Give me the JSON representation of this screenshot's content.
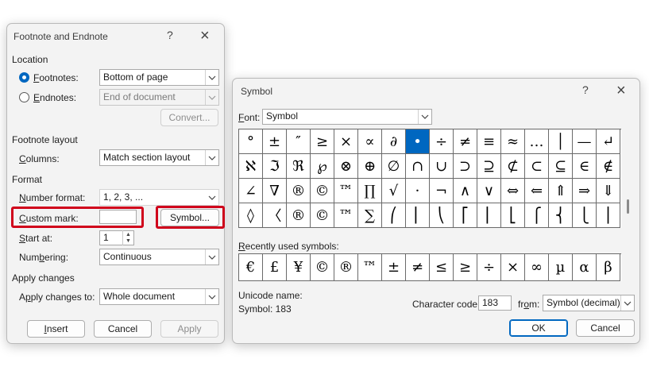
{
  "footnote_dialog": {
    "title": "Footnote and Endnote",
    "help": "?",
    "close": "×",
    "location": {
      "heading": "Location",
      "footnotes": {
        "label_key": "F",
        "label_rest": "ootnotes:",
        "value": "Bottom of page",
        "selected": true
      },
      "endnotes": {
        "label_key": "E",
        "label_rest": "ndnotes:",
        "value": "End of document",
        "selected": false
      },
      "convert": "Convert..."
    },
    "layout": {
      "heading": "Footnote layout",
      "columns_key": "C",
      "columns_rest": "olumns:",
      "columns_value": "Match section layout"
    },
    "format": {
      "heading": "Format",
      "number_format_key": "N",
      "number_format_rest": "umber format:",
      "number_format_value": "1, 2, 3, ...",
      "custom_mark_key": "C",
      "custom_mark_rest": "ustom mark:",
      "custom_mark_value": "",
      "symbol_button": "Symbol...",
      "start_at_key": "S",
      "start_at_rest": "tart at:",
      "start_at_value": "1",
      "numbering_pre": "Num",
      "numbering_key": "b",
      "numbering_rest": "ering:",
      "numbering_value": "Continuous"
    },
    "apply": {
      "heading": "Apply changes",
      "label_pre": "A",
      "label_key": "p",
      "label_rest": "ply changes to:",
      "value": "Whole document"
    },
    "buttons": {
      "insert_key": "I",
      "insert_rest": "nsert",
      "cancel": "Cancel",
      "apply": "Apply"
    }
  },
  "symbol_dialog": {
    "title": "Symbol",
    "help": "?",
    "close": "×",
    "font_key": "F",
    "font_rest": "ont:",
    "font_value": "Symbol",
    "symbols": [
      "°",
      "±",
      "″",
      "≥",
      "×",
      "∝",
      "∂",
      "•",
      "÷",
      "≠",
      "≡",
      "≈",
      "…",
      "│",
      "—",
      "↵",
      "ℵ",
      "ℑ",
      "ℜ",
      "℘",
      "⊗",
      "⊕",
      "∅",
      "∩",
      "∪",
      "⊃",
      "⊇",
      "⊄",
      "⊂",
      "⊆",
      "∈",
      "∉",
      "∠",
      "∇",
      "®",
      "©",
      "™",
      "∏",
      "√",
      "⋅",
      "¬",
      "∧",
      "∨",
      "⇔",
      "⇐",
      "⇑",
      "⇒",
      "⇓",
      "◊",
      "〈",
      "®",
      "©",
      "™",
      "∑",
      "⎛",
      "⎜",
      "⎝",
      "⎡",
      "⎢",
      "⎣",
      "⎧",
      "⎨",
      "⎩",
      "⎪"
    ],
    "selected_index": 7,
    "recent_key": "R",
    "recent_rest": "ecently used symbols:",
    "recent": [
      "€",
      "£",
      "¥",
      "©",
      "®",
      "™",
      "±",
      "≠",
      "≤",
      "≥",
      "÷",
      "×",
      "∞",
      "µ",
      "α",
      "β"
    ],
    "unicode_name_label": "Unicode name:",
    "symbol_code_text": "Symbol: 183",
    "char_code_pre": "Character code:",
    "char_code_value": "183",
    "from_pre": "fr",
    "from_key": "o",
    "from_rest": "m:",
    "from_value": "Symbol (decimal)",
    "ok": "OK",
    "cancel": "Cancel"
  },
  "colors": {
    "accent": "#0067c0",
    "highlight": "#d0021b"
  }
}
